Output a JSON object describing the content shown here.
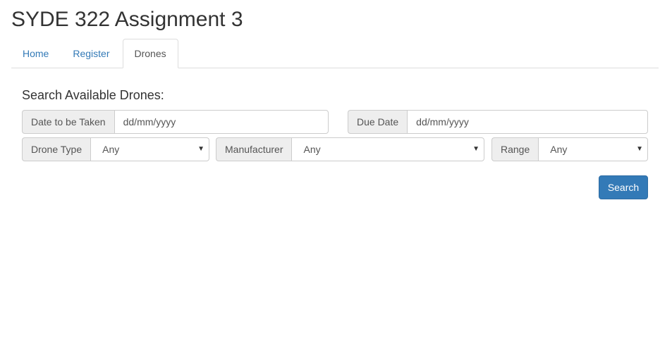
{
  "app": {
    "title": "SYDE 322 Assignment 3"
  },
  "nav": {
    "tabs": [
      {
        "label": "Home",
        "active": false
      },
      {
        "label": "Register",
        "active": false
      },
      {
        "label": "Drones",
        "active": true
      }
    ]
  },
  "search": {
    "heading": "Search Available Drones:",
    "date_taken": {
      "label": "Date to be Taken",
      "value": "dd/mm/yyyy"
    },
    "due_date": {
      "label": "Due Date",
      "value": "dd/mm/yyyy"
    },
    "drone_type": {
      "label": "Drone Type",
      "value": "Any"
    },
    "manufacturer": {
      "label": "Manufacturer",
      "value": "Any"
    },
    "range": {
      "label": "Range",
      "value": "Any"
    },
    "button_label": "Search"
  },
  "colors": {
    "primary": "#337ab7",
    "addon_background": "#eeeeee",
    "border": "#cccccc"
  }
}
